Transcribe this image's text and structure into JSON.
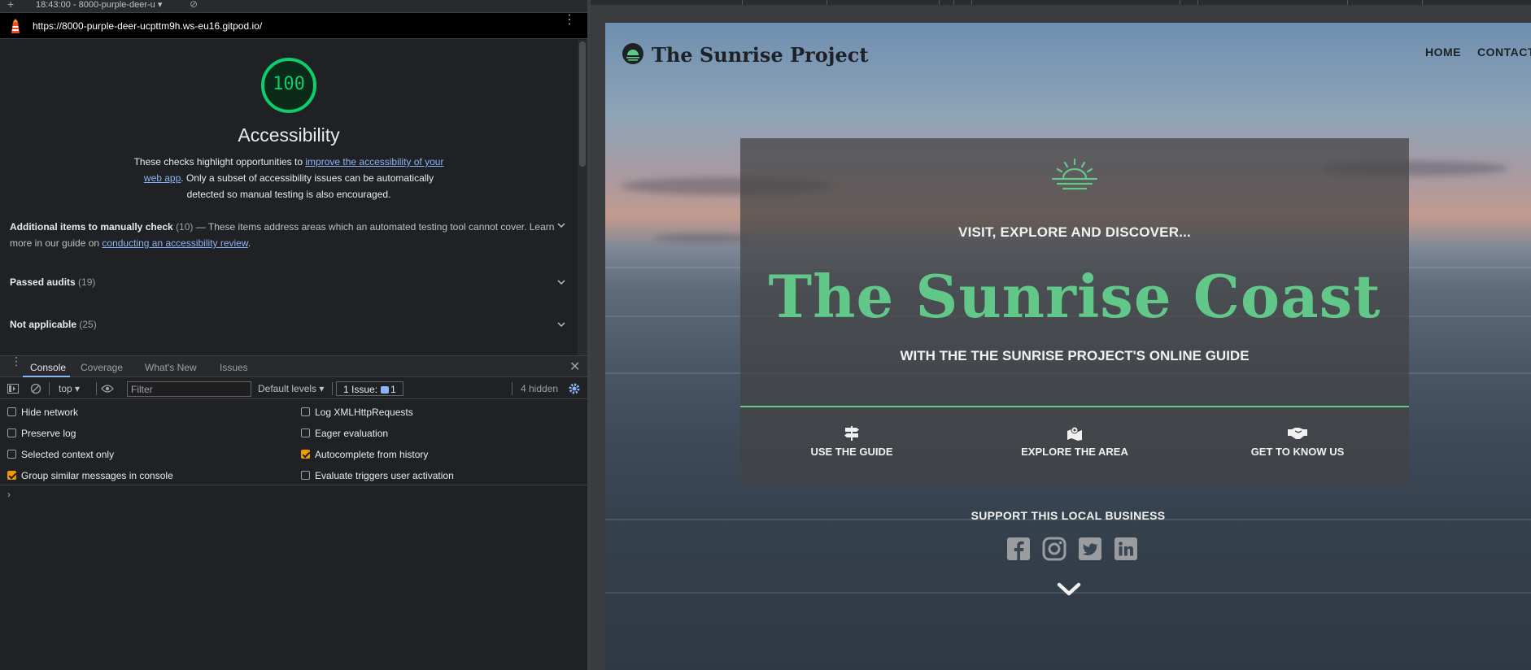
{
  "devtools": {
    "topbar": {
      "plus": "+",
      "tab_title": "18:43:00 - 8000-purple-deer-u ▾"
    },
    "url": "https://8000-purple-deer-ucpttm9h.ws-eu16.gitpod.io/",
    "lighthouse": {
      "score": "100",
      "category_title": "Accessibility",
      "desc_pre": "These checks highlight opportunities to ",
      "desc_link": "improve the accessibility of your web app",
      "desc_post": ". Only a subset of accessibility issues can be automatically detected so manual testing is also encouraged.",
      "groups": [
        {
          "title": "Additional items to manually check",
          "count": "(10)",
          "text_pre": " — These items address areas which an automated testing tool cannot cover. Learn more in our guide on ",
          "link": "conducting an accessibility review",
          "text_post": "."
        },
        {
          "title": "Passed audits",
          "count": "(19)"
        },
        {
          "title": "Not applicable",
          "count": "(25)"
        }
      ]
    },
    "drawer": {
      "tabs": [
        "Console",
        "Coverage",
        "What's New",
        "Issues"
      ],
      "active_tab": "Console",
      "context": "top ▾",
      "filter_placeholder": "Filter",
      "levels": "Default levels ▾",
      "issues_label": "1 Issue:",
      "issues_count": "1",
      "hidden": "4 hidden",
      "settings_left": [
        {
          "label": "Hide network",
          "checked": false
        },
        {
          "label": "Preserve log",
          "checked": false
        },
        {
          "label": "Selected context only",
          "checked": false
        },
        {
          "label": "Group similar messages in console",
          "checked": true
        }
      ],
      "settings_right": [
        {
          "label": "Log XMLHttpRequests",
          "checked": false
        },
        {
          "label": "Eager evaluation",
          "checked": false
        },
        {
          "label": "Autocomplete from history",
          "checked": true
        },
        {
          "label": "Evaluate triggers user activation",
          "checked": false
        }
      ],
      "prompt": "›"
    }
  },
  "site": {
    "brand": "The Sunrise Project",
    "nav": [
      "HOME",
      "CONTACT"
    ],
    "hero": {
      "kicker_pre": "VISIT, EXPLORE AND ",
      "kicker_bold": "DISCOVER...",
      "headline": "The Sunrise Coast",
      "subline": "WITH THE THE SUNRISE PROJECT'S ONLINE GUIDE",
      "features": [
        {
          "label": "USE THE GUIDE",
          "icon": "signpost-icon"
        },
        {
          "label": "EXPLORE THE AREA",
          "icon": "map-marker-icon"
        },
        {
          "label": "GET TO KNOW US",
          "icon": "handshake-icon"
        }
      ]
    },
    "support_label": "SUPPORT THIS LOCAL BUSINESS",
    "socials": [
      "facebook-icon",
      "instagram-icon",
      "twitter-icon",
      "linkedin-icon"
    ],
    "colors": {
      "accent": "#62c889",
      "lighthouse_green": "#0cce6b",
      "devtools_bg": "#202124",
      "link": "#8ab4f8",
      "checkbox_checked": "#f29900"
    }
  }
}
